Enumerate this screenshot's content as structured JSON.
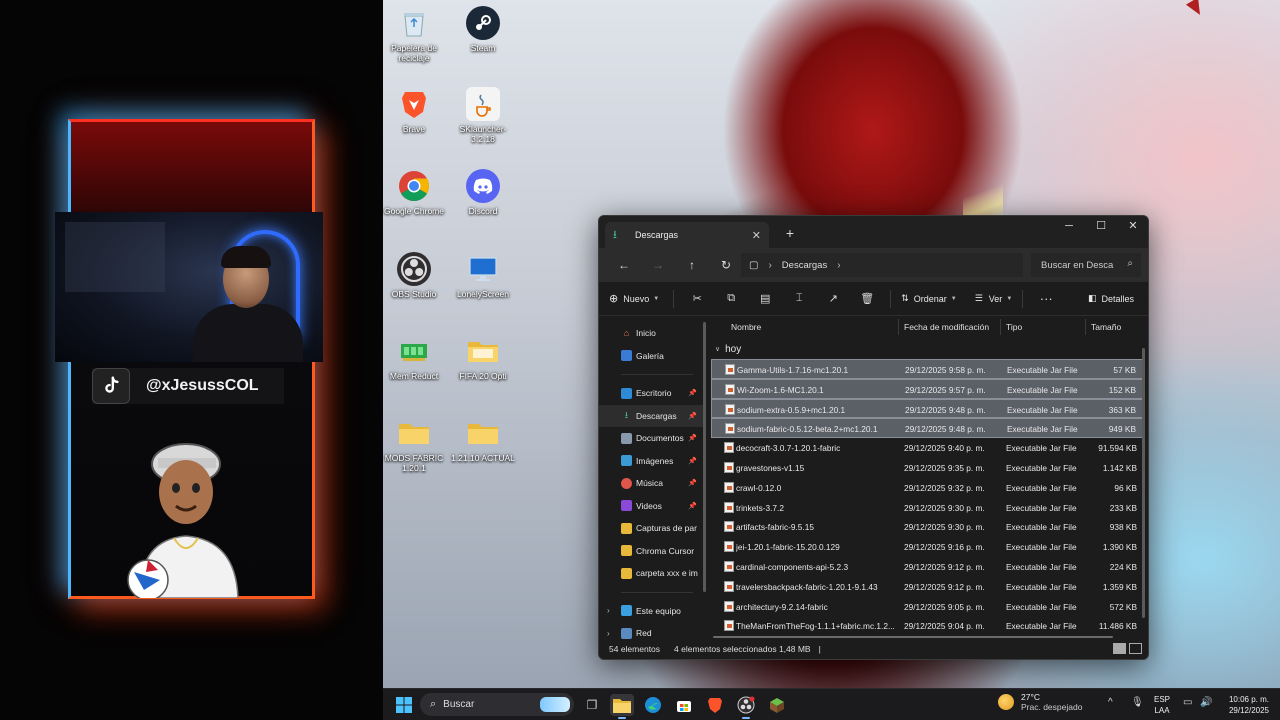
{
  "overlay": {
    "social_handle": "@xJesussCOL"
  },
  "desktop": {
    "icons": [
      {
        "label": "Papelera de reciclaje",
        "icon": "recycle-bin-icon"
      },
      {
        "label": "Steam",
        "icon": "steam-icon"
      },
      {
        "label": "Brave",
        "icon": "brave-icon"
      },
      {
        "label": "SKlauncher-3.2.18",
        "icon": "java-icon"
      },
      {
        "label": "Google Chrome",
        "icon": "chrome-icon"
      },
      {
        "label": "Discord",
        "icon": "discord-icon"
      },
      {
        "label": "OBS Studio",
        "icon": "obs-icon"
      },
      {
        "label": "LonelyScreen",
        "icon": "monitor-icon"
      },
      {
        "label": "Mem Reduct",
        "icon": "memory-icon"
      },
      {
        "label": "FIFA 20 Opti",
        "icon": "folder-icon"
      },
      {
        "label": "MODS FABRIC 1.20.1",
        "icon": "folder-icon"
      },
      {
        "label": "1.21.10 ACTUAL",
        "icon": "folder-icon"
      }
    ]
  },
  "explorer": {
    "tab_title": "Descargas",
    "address": "Descargas",
    "search_placeholder": "Buscar en Desca",
    "toolbar": {
      "new_label": "Nuevo",
      "sort_label": "Ordenar",
      "view_label": "Ver",
      "details_label": "Detalles"
    },
    "sidebar": [
      {
        "label": "Inicio",
        "icon": "home-icon",
        "pinned": false
      },
      {
        "label": "Galería",
        "icon": "gallery-icon",
        "pinned": false
      },
      {
        "label": "Escritorio",
        "icon": "desktop-folder-icon",
        "pinned": true
      },
      {
        "label": "Descargas",
        "icon": "download-icon",
        "pinned": true
      },
      {
        "label": "Documentos",
        "icon": "documents-icon",
        "pinned": true
      },
      {
        "label": "Imágenes",
        "icon": "pictures-icon",
        "pinned": true
      },
      {
        "label": "Música",
        "icon": "music-icon",
        "pinned": true
      },
      {
        "label": "Videos",
        "icon": "videos-icon",
        "pinned": true
      },
      {
        "label": "Capturas de par",
        "icon": "folder-icon",
        "pinned": false
      },
      {
        "label": "Chroma Cursor",
        "icon": "folder-icon",
        "pinned": false
      },
      {
        "label": "carpeta xxx e im",
        "icon": "folder-icon",
        "pinned": false
      },
      {
        "label": "Este equipo",
        "icon": "pc-icon",
        "pinned": false
      },
      {
        "label": "Red",
        "icon": "network-icon",
        "pinned": false
      }
    ],
    "columns": {
      "name": "Nombre",
      "modified": "Fecha de modificación",
      "type": "Tipo",
      "size": "Tamaño"
    },
    "group_label": "hoy",
    "files": [
      {
        "name": "Gamma-Utils-1.7.16-mc1.20.1",
        "date": "29/12/2025 9:58 p. m.",
        "type": "Executable Jar File",
        "size": "57 KB",
        "selected": true
      },
      {
        "name": "Wi-Zoom-1.6-MC1.20.1",
        "date": "29/12/2025 9:57 p. m.",
        "type": "Executable Jar File",
        "size": "152 KB",
        "selected": true
      },
      {
        "name": "sodium-extra-0.5.9+mc1.20.1",
        "date": "29/12/2025 9:48 p. m.",
        "type": "Executable Jar File",
        "size": "363 KB",
        "selected": true
      },
      {
        "name": "sodium-fabric-0.5.12-beta.2+mc1.20.1",
        "date": "29/12/2025 9:48 p. m.",
        "type": "Executable Jar File",
        "size": "949 KB",
        "selected": true
      },
      {
        "name": "decocraft-3.0.7-1.20.1-fabric",
        "date": "29/12/2025 9:40 p. m.",
        "type": "Executable Jar File",
        "size": "91.594 KB",
        "selected": false
      },
      {
        "name": "gravestones-v1.15",
        "date": "29/12/2025 9:35 p. m.",
        "type": "Executable Jar File",
        "size": "1.142 KB",
        "selected": false
      },
      {
        "name": "crawl-0.12.0",
        "date": "29/12/2025 9:32 p. m.",
        "type": "Executable Jar File",
        "size": "96 KB",
        "selected": false
      },
      {
        "name": "trinkets-3.7.2",
        "date": "29/12/2025 9:30 p. m.",
        "type": "Executable Jar File",
        "size": "233 KB",
        "selected": false
      },
      {
        "name": "artifacts-fabric-9.5.15",
        "date": "29/12/2025 9:30 p. m.",
        "type": "Executable Jar File",
        "size": "938 KB",
        "selected": false
      },
      {
        "name": "jei-1.20.1-fabric-15.20.0.129",
        "date": "29/12/2025 9:16 p. m.",
        "type": "Executable Jar File",
        "size": "1.390 KB",
        "selected": false
      },
      {
        "name": "cardinal-components-api-5.2.3",
        "date": "29/12/2025 9:12 p. m.",
        "type": "Executable Jar File",
        "size": "224 KB",
        "selected": false
      },
      {
        "name": "travelersbackpack-fabric-1.20.1-9.1.43",
        "date": "29/12/2025 9:12 p. m.",
        "type": "Executable Jar File",
        "size": "1.359 KB",
        "selected": false
      },
      {
        "name": "architectury-9.2.14-fabric",
        "date": "29/12/2025 9:05 p. m.",
        "type": "Executable Jar File",
        "size": "572 KB",
        "selected": false
      },
      {
        "name": "TheManFromTheFog-1.1.1+fabric.mc.1.2...",
        "date": "29/12/2025 9:04 p. m.",
        "type": "Executable Jar File",
        "size": "11.486 KB",
        "selected": false
      }
    ],
    "status": {
      "count": "54 elementos",
      "selection": "4 elementos seleccionados  1,48 MB"
    }
  },
  "taskbar": {
    "search_placeholder": "Buscar",
    "weather_temp": "27°C",
    "weather_desc": "Prac. despejado",
    "lang_top": "ESP",
    "lang_bottom": "LAA",
    "time": "10:06 p. m.",
    "date": "29/12/2025",
    "accent": "#0078d4"
  }
}
